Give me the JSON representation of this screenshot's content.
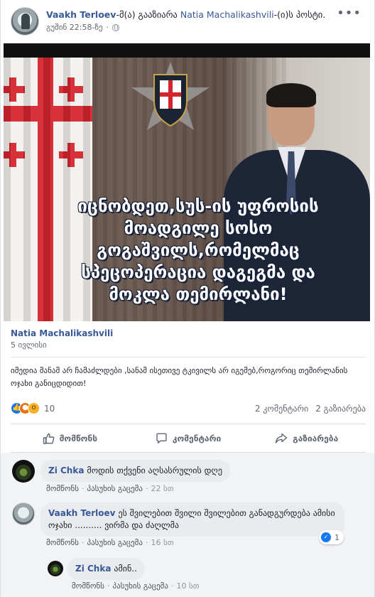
{
  "header": {
    "author": "Vaakh Terloev",
    "shared_text_before": "-მ(ა) გააზიარა ",
    "original_author_link": "Natia Machalikashvili",
    "shared_text_after": "-(ი)ს პოსტი.",
    "timestamp": "გუშინ 22:58-ზე",
    "separator": "·",
    "privacy_icon": "globe-icon",
    "more_icon": "ellipsis-icon",
    "more_label": "•••"
  },
  "image": {
    "caption_lines": [
      "იცნობდეთ,სუს-ის უფროსის",
      "მოადგილე სოსო",
      "გოგაშვილს,რომელმაც",
      "სპეცოპერაცია დაგეგმა და",
      "მოკლა თემირლანი!"
    ]
  },
  "original_post": {
    "author": "Natia Machalikashvili",
    "date": "5 ივლისი",
    "text": "იმედია მანამ არ ჩამაძლდები ,სანამ ისეთივე ტკივილს არ იგემებ,როგორიც თემირლანის ოჯახი განიცდიდით!"
  },
  "reactions": {
    "icons": [
      "like-icon",
      "angry-icon",
      "wow-icon"
    ],
    "count": "10",
    "comments": "2 კომენტარი",
    "shares": "2 გაზიარება"
  },
  "actions": {
    "like": "მომწონს",
    "comment": "კომენტარი",
    "share": "გაზიარება"
  },
  "comments": [
    {
      "author": "Zi Chka",
      "text": "მოდის თქვენი აღსასრულის დღე",
      "like": "მომწონს",
      "reply": "პასუხის გაცემა",
      "time": "22 სთ"
    },
    {
      "author": "Vaakh Terloev",
      "text": "ეს შვილებით შვილი შვილებით განადგურდება ამისი ოჯახი .......... ვირმა და ძაღლმა",
      "like": "მომწონს",
      "reply": "პასუხის გაცემა",
      "time": "16 სთ",
      "like_count": "1"
    },
    {
      "author": "Zi Chka",
      "text": "ამინ..",
      "like": "მომწონს",
      "reply": "პასუხის გაცემა",
      "time": "10 სთ"
    }
  ],
  "colors": {
    "link": "#385898",
    "like_blue": "#1877f2",
    "flag_red": "#d5252d"
  }
}
